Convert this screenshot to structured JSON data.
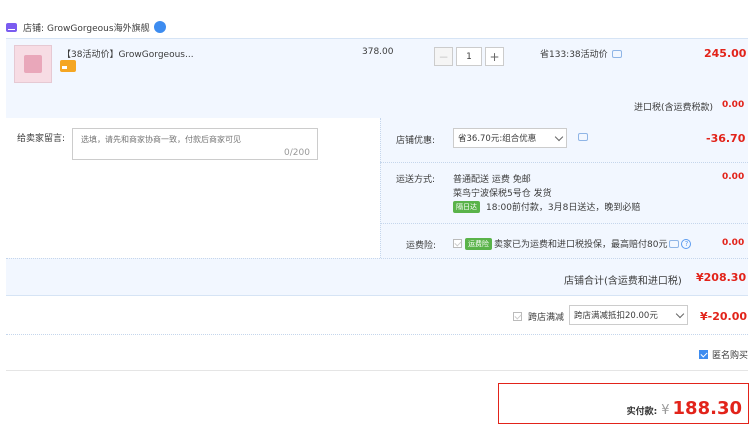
{
  "store": {
    "label": "店铺:",
    "name": "GrowGorgeous海外旗舰"
  },
  "item": {
    "title": "【38活动价】GrowGorgeous...",
    "unit_price": "378.00",
    "quantity": "1",
    "minus_label": "−",
    "plus_label": "+",
    "promo": "省133:38活动价",
    "subtotal": "245.00",
    "import_tax_label": "进口税(含运费税款)",
    "import_tax_value": "0.00"
  },
  "message": {
    "label": "给卖家留言:",
    "placeholder": "选填，请先和商家协商一致，付款后商家可见",
    "counter": "0/200"
  },
  "discount": {
    "label": "店铺优惠:",
    "selected": "省36.70元:组合优惠",
    "value": "-36.70"
  },
  "shipping": {
    "label": "运送方式:",
    "method": "普通配送 运费 免邮",
    "warehouse": "菜鸟宁波保税5号仓  发货",
    "badge": "隔日达",
    "delivery_note": "18:00前付款，3月8日送达，晚到必赔",
    "value": "0.00"
  },
  "insurance": {
    "label": "运费险:",
    "badge": "运费险",
    "text": "卖家已为运费和进口税投保，最高赔付80元",
    "help": "?",
    "value": "0.00"
  },
  "store_total": {
    "label": "店铺合计(含运费和进口税)",
    "value": "¥208.30"
  },
  "cross_store": {
    "label": "跨店满减",
    "selected": "跨店满减抵扣20.00元",
    "value": "¥-20.00"
  },
  "anonymous": {
    "label": "匿名购买",
    "checked": true
  },
  "payment": {
    "label": "实付款:",
    "currency": "¥",
    "amount": "188.30"
  },
  "colors": {
    "accent_red": "#e2231a",
    "panel_blue": "#f2f7ff",
    "brand_purple": "#7a5cf0",
    "link_blue": "#3d8cf0"
  }
}
